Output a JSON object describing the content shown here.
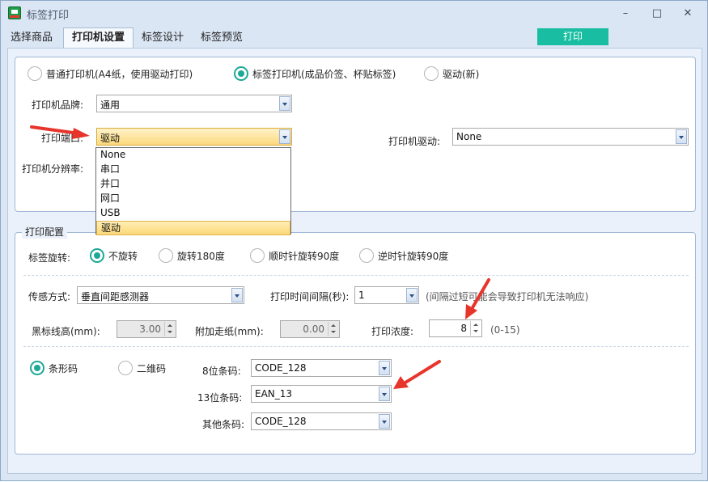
{
  "window": {
    "title": "标签打印",
    "minimize": "–",
    "maximize": "□",
    "close": "✕"
  },
  "tabs": [
    {
      "label": "选择商品"
    },
    {
      "label": "打印机设置"
    },
    {
      "label": "标签设计"
    },
    {
      "label": "标签预览"
    }
  ],
  "print_button": "打印",
  "printer_type": {
    "options": [
      "普通打印机(A4纸，使用驱动打印)",
      "标签打印机(成品价签、杯贴标签)",
      "驱动(新)"
    ],
    "selected": 1
  },
  "printer_brand": {
    "label": "打印机品牌:",
    "value": "通用"
  },
  "printer_port": {
    "label": "打印端口:",
    "value": "驱动"
  },
  "printer_resolution": {
    "label": "打印机分辨率:"
  },
  "printer_driver": {
    "label": "打印机驱动:",
    "value": "None"
  },
  "port_dropdown": {
    "options": [
      "None",
      "串口",
      "并口",
      "网口",
      "USB",
      "驱动"
    ],
    "selected": 5
  },
  "print_config": {
    "title": "打印配置",
    "rotation_label": "标签旋转:",
    "rotation_options": [
      "不旋转",
      "旋转180度",
      "顺时针旋转90度",
      "逆时针旋转90度"
    ],
    "rotation_selected": 0,
    "sensor_label": "传感方式:",
    "sensor_value": "垂直间距感测器",
    "interval_label": "打印时间间隔(秒):",
    "interval_value": "1",
    "interval_note": "(间隔过短可能会导致打印机无法响应)",
    "black_mark_label": "黑标线高(mm):",
    "black_mark_value": "3.00",
    "extra_feed_label": "附加走纸(mm):",
    "extra_feed_value": "0.00",
    "density_label": "打印浓度:",
    "density_value": "8",
    "density_note": "(0-15)",
    "code_type_options": [
      "条形码",
      "二维码"
    ],
    "code_type_selected": 0,
    "barcode8_label": "8位条码:",
    "barcode8_value": "CODE_128",
    "barcode13_label": "13位条码:",
    "barcode13_value": "EAN_13",
    "barcode_other_label": "其他条码:",
    "barcode_other_value": "CODE_128"
  },
  "colors": {
    "accent": "#1ea898",
    "print_button": "#19bea2",
    "arrow": "#e8352b",
    "highlight": "#fcd877"
  }
}
